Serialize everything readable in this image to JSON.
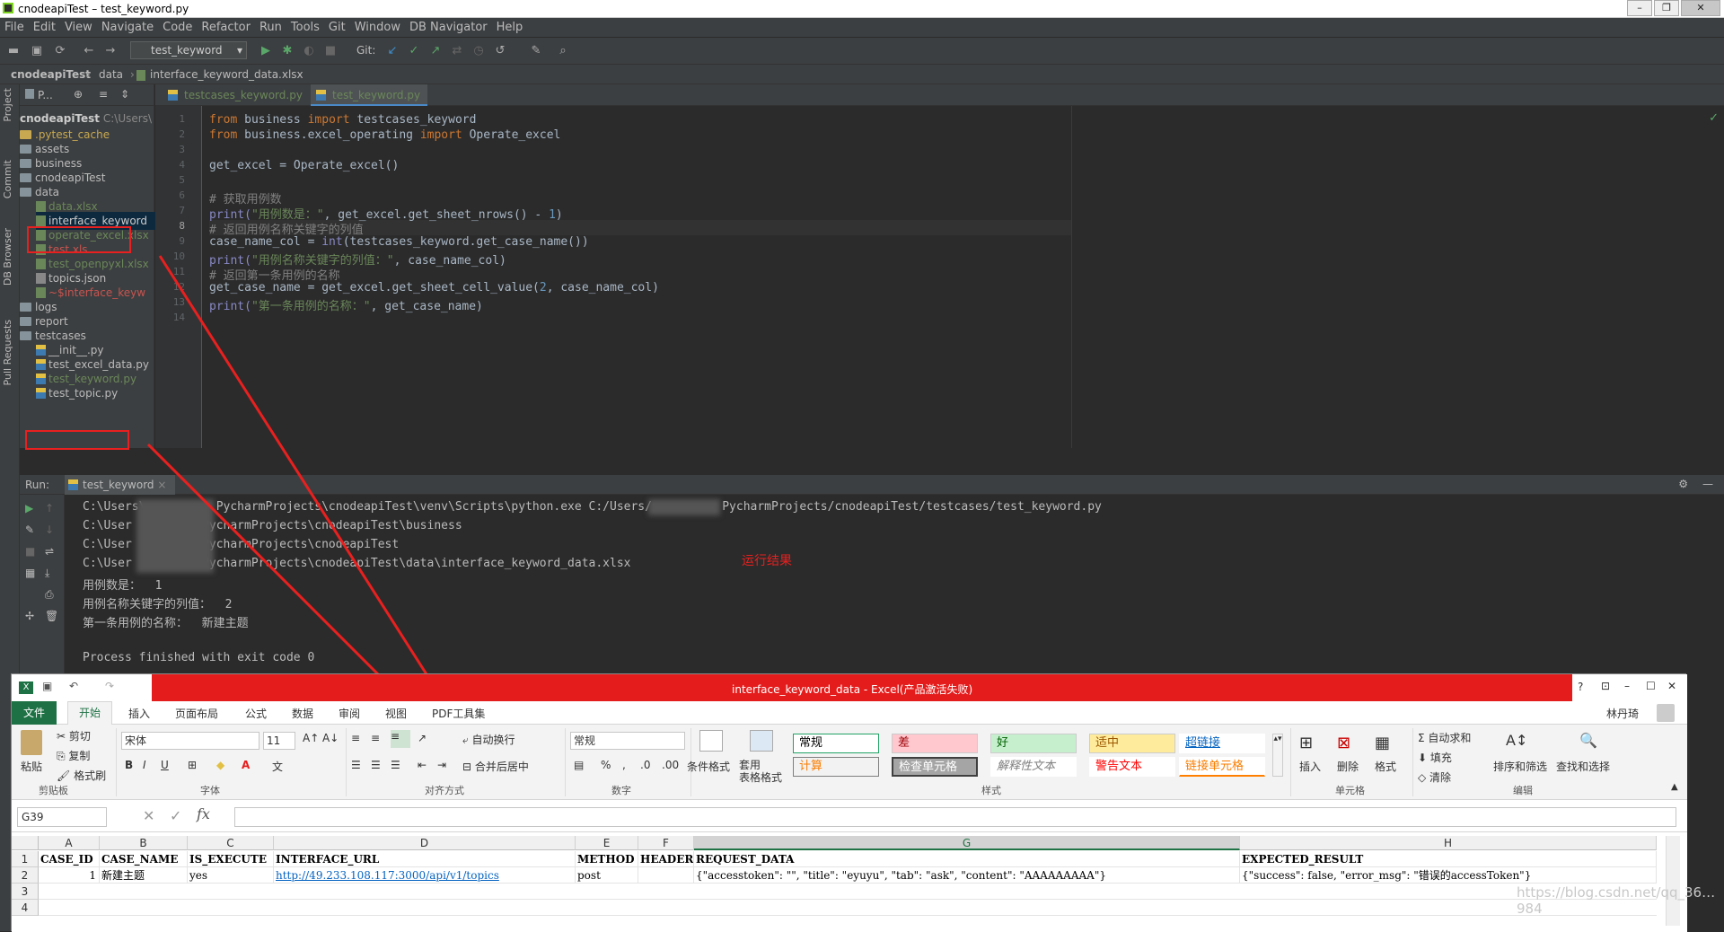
{
  "window": {
    "title": "cnodeapiTest – test_keyword.py"
  },
  "menu": [
    "File",
    "Edit",
    "View",
    "Navigate",
    "Code",
    "Refactor",
    "Run",
    "Tools",
    "Git",
    "Window",
    "DB Navigator",
    "Help"
  ],
  "toolbar": {
    "run_config": "test_keyword",
    "git_label": "Git:"
  },
  "breadcrumbs": {
    "project": "cnodeapiTest",
    "folder": "data",
    "file": "interface_keyword_data.xlsx"
  },
  "left_tool_tabs": [
    "Project",
    "Commit",
    "DB Browser",
    "Pull Requests"
  ],
  "project_panel": {
    "header": "P...",
    "root": "cnodeapiTest",
    "root_path": "C:\\Users\\",
    "items": [
      ".pytest_cache",
      "assets",
      "business",
      "cnodeapiTest",
      "data",
      "data.xlsx",
      "interface_keyword",
      "operate_excel.xlsx",
      "test.xls",
      "test_openpyxl.xlsx",
      "topics.json",
      "~$interface_keyw",
      "logs",
      "report",
      "testcases",
      "__init__.py",
      "test_excel_data.py",
      "test_keyword.py",
      "test_topic.py"
    ]
  },
  "editor_tabs": [
    "testcases_keyword.py",
    "test_keyword.py"
  ],
  "line_numbers": [
    "1",
    "2",
    "3",
    "4",
    "5",
    "6",
    "7",
    "8",
    "9",
    "10",
    "11",
    "12",
    "13",
    "14"
  ],
  "code": {
    "l1_kw1": "from",
    "l1_mod": " business ",
    "l1_kw2": "import",
    "l1_name": " testcases_keyword",
    "l2_kw1": "from",
    "l2_mod": " business.excel_operating ",
    "l2_kw2": "import",
    "l2_name": " Operate_excel",
    "l4": "get_excel = Operate_excel()",
    "l6": "# 获取用例数",
    "l7_a": "print(",
    "l7_s": "\"用例数是：\"",
    "l7_b": ", get_excel.get_sheet_nrows() - ",
    "l7_n": "1",
    "l7_c": ")",
    "l8": "# 返回用例名称关键字的列值",
    "l9_a": "case_name_col = ",
    "l9_f": "int",
    "l9_b": "(testcases_keyword.get_case_name())",
    "l10_a": "print(",
    "l10_s": "\"用例名称关键字的列值：\"",
    "l10_b": ", case_name_col)",
    "l11": "# 返回第一条用例的名称",
    "l12_a": "get_case_name = get_excel.get_sheet_cell_value(",
    "l12_n": "2",
    "l12_b": ", case_name_col)",
    "l13_a": "print(",
    "l13_s": "\"第一条用例的名称：\"",
    "l13_b": ", get_case_name)"
  },
  "run": {
    "label": "Run:",
    "tab": "test_keyword",
    "lines": [
      "C:\\Users\\          PycharmProjects\\cnodeapiTest\\venv\\Scripts\\python.exe C:/Users/          PycharmProjects/cnodeapiTest/testcases/test_keyword.py",
      "C:\\User          PycharmProjects\\cnodeapiTest\\business",
      "C:\\User          PycharmProjects\\cnodeapiTest",
      "C:\\User          PycharmProjects\\cnodeapiTest\\data\\interface_keyword_data.xlsx",
      "用例数是：  1",
      "用例名称关键字的列值：  2",
      "第一条用例的名称：  新建主题",
      "",
      "Process finished with exit code 0"
    ],
    "annotation": "运行结果"
  },
  "excel": {
    "title": "interface_keyword_data -  Excel(产品激活失败)",
    "help": "?",
    "user": "林丹琦",
    "tabs": [
      "文件",
      "开始",
      "插入",
      "页面布局",
      "公式",
      "数据",
      "审阅",
      "视图",
      "PDF工具集"
    ],
    "clipboard": {
      "paste": "粘贴",
      "cut": "剪切",
      "copy": "复制",
      "format_painter": "格式刷",
      "group": "剪贴板"
    },
    "font": {
      "name": "宋体",
      "size": "11",
      "group": "字体"
    },
    "alignment": {
      "wrap": "自动换行",
      "merge": "合并后居中",
      "group": "对齐方式"
    },
    "number": {
      "format": "常规",
      "group": "数字"
    },
    "styles": {
      "cond": "条件格式",
      "table": "套用\n表格格式",
      "normal": "常规",
      "bad": "差",
      "good": "好",
      "neutral": "适中",
      "hyperlink": "超链接",
      "calc": "计算",
      "check": "检查单元格",
      "explain": "解释性文本",
      "warning": "警告文本",
      "linked": "链接单元格",
      "group": "样式"
    },
    "cells": {
      "insert": "插入",
      "delete": "删除",
      "format": "格式",
      "group": "单元格"
    },
    "editing": {
      "autosum": "自动求和",
      "fill": "填充",
      "clear": "清除",
      "sort": "排序和筛选",
      "find": "查找和选择",
      "group": "编辑"
    },
    "namebox": "G39",
    "columns": [
      "A",
      "B",
      "C",
      "D",
      "E",
      "F",
      "G",
      "H"
    ],
    "rows": [
      "1",
      "2",
      "3",
      "4"
    ],
    "header_row": [
      "CASE_ID",
      "CASE_NAME",
      "IS_EXECUTE",
      "INTERFACE_URL",
      "METHOD",
      "HEADER",
      "REQUEST_DATA",
      "EXPECTED_RESULT"
    ],
    "data_row": [
      "1",
      "新建主题",
      "yes",
      "http://49.233.108.117:3000/api/v1/topics",
      "post",
      "",
      "{\"accesstoken\": \"\", \"title\": \"eyuyu\", \"tab\": \"ask\", \"content\": \"AAAAAAAAA\"}",
      "{\"success\": false, \"error_msg\": \"错误的accessToken\"}"
    ],
    "watermark": "https://blog.csdn.net/qq_36…984"
  },
  "colors": {
    "red_annotation": "#e8201f",
    "excel_title": "#e51c1c"
  }
}
